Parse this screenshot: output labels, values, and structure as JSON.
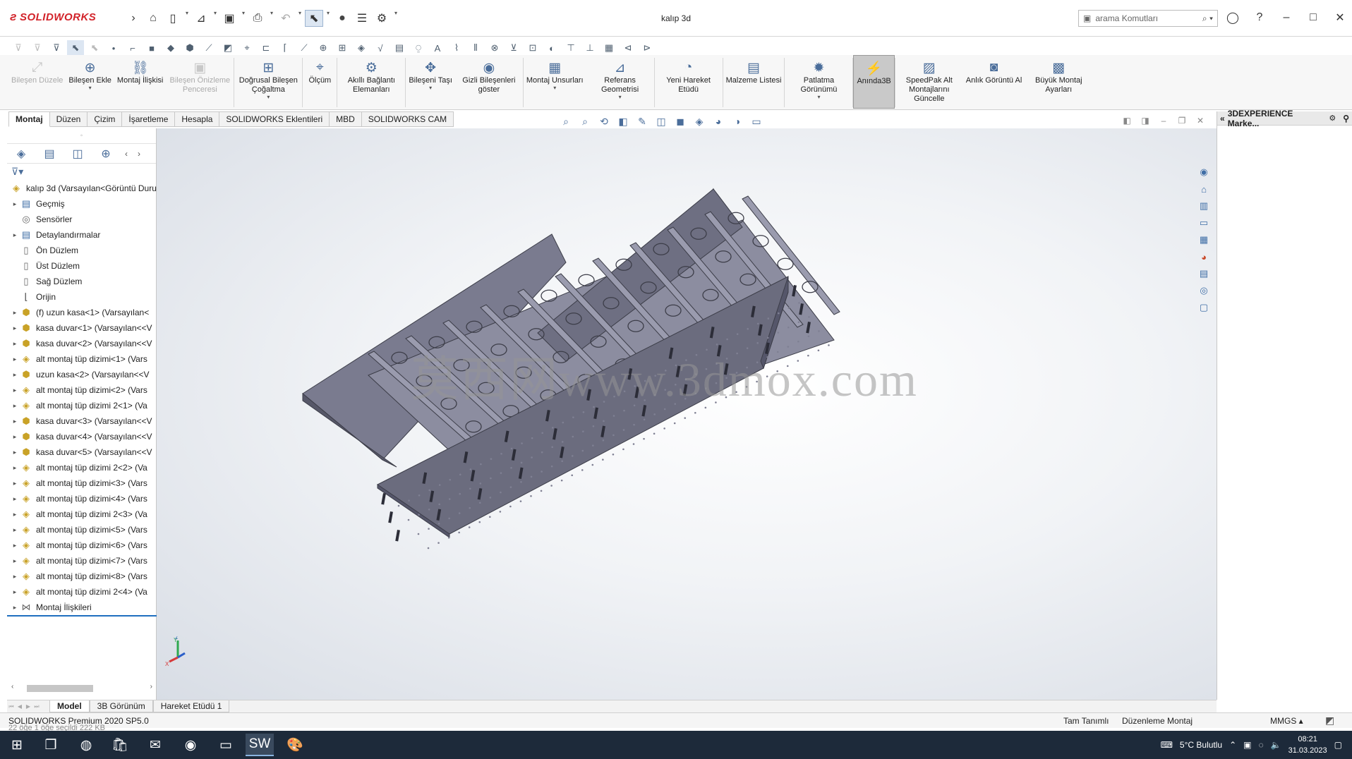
{
  "app": {
    "logo": "SOLIDWORKS",
    "doc_title": "kalıp 3d"
  },
  "search": {
    "placeholder": "arama Komutları"
  },
  "commands": [
    {
      "label": "Bileşen Düzele",
      "disabled": true,
      "dropdown": false
    },
    {
      "label": "Bileşen Ekle",
      "disabled": false,
      "dropdown": true
    },
    {
      "label": "Montaj İlişkisi",
      "disabled": false,
      "dropdown": false
    },
    {
      "label": "Bileşen Önizleme Penceresi",
      "disabled": true,
      "dropdown": false
    },
    {
      "label": "Doğrusal Bileşen Çoğaltma",
      "disabled": false,
      "dropdown": true
    },
    {
      "label": "Ölçüm",
      "disabled": false,
      "dropdown": false
    },
    {
      "label": "Akıllı Bağlantı Elemanları",
      "disabled": false,
      "dropdown": false
    },
    {
      "label": "Bileşeni Taşı",
      "disabled": false,
      "dropdown": true
    },
    {
      "label": "Gizli Bileşenleri göster",
      "disabled": false,
      "dropdown": false
    },
    {
      "label": "Montaj Unsurları",
      "disabled": false,
      "dropdown": true
    },
    {
      "label": "Referans Geometrisi",
      "disabled": false,
      "dropdown": true
    },
    {
      "label": "Yeni Hareket Etüdü",
      "disabled": false,
      "dropdown": false
    },
    {
      "label": "Malzeme Listesi",
      "disabled": false,
      "dropdown": false
    },
    {
      "label": "Patlatma Görünümü",
      "disabled": false,
      "dropdown": true
    },
    {
      "label": "Anında3B",
      "disabled": false,
      "dropdown": false,
      "active": true
    },
    {
      "label": "SpeedPak Alt Montajlarını Güncelle",
      "disabled": false,
      "dropdown": false
    },
    {
      "label": "Anlık Görüntü Al",
      "disabled": false,
      "dropdown": false
    },
    {
      "label": "Büyük Montaj Ayarları",
      "disabled": false,
      "dropdown": false
    }
  ],
  "tabs": [
    "Montaj",
    "Düzen",
    "Çizim",
    "İşaretleme",
    "Hesapla",
    "SOLIDWORKS Eklentileri",
    "MBD",
    "SOLIDWORKS CAM"
  ],
  "active_tab": "Montaj",
  "tree": [
    {
      "label": "kalıp 3d  (Varsayılan<Görüntü Duru",
      "type": "root",
      "expand": ""
    },
    {
      "label": "Geçmiş",
      "type": "fold",
      "expand": "▸"
    },
    {
      "label": "Sensörler",
      "type": "sens",
      "expand": ""
    },
    {
      "label": "Detaylandırmalar",
      "type": "fold",
      "expand": "▸"
    },
    {
      "label": "Ön Düzlem",
      "type": "plane",
      "expand": ""
    },
    {
      "label": "Üst Düzlem",
      "type": "plane",
      "expand": ""
    },
    {
      "label": "Sağ Düzlem",
      "type": "plane",
      "expand": ""
    },
    {
      "label": "Orijin",
      "type": "orig",
      "expand": ""
    },
    {
      "label": "(f) uzun kasa<1> (Varsayılan<",
      "type": "part",
      "expand": "▸"
    },
    {
      "label": "kasa duvar<1> (Varsayılan<<V",
      "type": "part",
      "expand": "▸"
    },
    {
      "label": "kasa duvar<2> (Varsayılan<<V",
      "type": "part",
      "expand": "▸"
    },
    {
      "label": "alt montaj tüp dizimi<1> (Vars",
      "type": "asm",
      "expand": "▸"
    },
    {
      "label": "uzun kasa<2> (Varsayılan<<V",
      "type": "part",
      "expand": "▸"
    },
    {
      "label": "alt montaj tüp dizimi<2> (Vars",
      "type": "asm",
      "expand": "▸"
    },
    {
      "label": "alt montaj tüp dizimi 2<1> (Va",
      "type": "asm",
      "expand": "▸"
    },
    {
      "label": "kasa duvar<3> (Varsayılan<<V",
      "type": "part",
      "expand": "▸"
    },
    {
      "label": "kasa duvar<4> (Varsayılan<<V",
      "type": "part",
      "expand": "▸"
    },
    {
      "label": "kasa duvar<5> (Varsayılan<<V",
      "type": "part",
      "expand": "▸"
    },
    {
      "label": "alt montaj tüp dizimi 2<2> (Va",
      "type": "asm",
      "expand": "▸"
    },
    {
      "label": "alt montaj tüp dizimi<3> (Vars",
      "type": "asm",
      "expand": "▸"
    },
    {
      "label": "alt montaj tüp dizimi<4> (Vars",
      "type": "asm",
      "expand": "▸"
    },
    {
      "label": "alt montaj tüp dizimi 2<3> (Va",
      "type": "asm",
      "expand": "▸"
    },
    {
      "label": "alt montaj tüp dizimi<5> (Vars",
      "type": "asm",
      "expand": "▸"
    },
    {
      "label": "alt montaj tüp dizimi<6> (Vars",
      "type": "asm",
      "expand": "▸"
    },
    {
      "label": "alt montaj tüp dizimi<7> (Vars",
      "type": "asm",
      "expand": "▸"
    },
    {
      "label": "alt montaj tüp dizimi<8> (Vars",
      "type": "asm",
      "expand": "▸"
    },
    {
      "label": "alt montaj tüp dizimi 2<4> (Va",
      "type": "asm",
      "expand": "▸"
    },
    {
      "label": "Montaj İlişkileri",
      "type": "mate",
      "expand": "▸"
    }
  ],
  "watermark": "莫西网www.3dmox.com",
  "right_panel": {
    "title": "3DEXPERIENCE Marke..."
  },
  "bottom_tabs": [
    "Model",
    "3B Görünüm",
    "Hareket Etüdü 1"
  ],
  "active_bottom_tab": "Model",
  "status": {
    "product": "SOLIDWORKS Premium 2020 SP5.0",
    "definition": "Tam Tanımlı",
    "mode": "Düzenleme Montaj",
    "units": "MMGS"
  },
  "under_status": "22 öğe    1 öğe seçildi 222 KB",
  "taskbar": {
    "weather": "5°C  Bulutlu",
    "time": "08:21",
    "date": "31.03.2023"
  },
  "colors": {
    "brand": "#d2232a",
    "accent": "#1f6fbf",
    "model": "#6b6c7e"
  }
}
